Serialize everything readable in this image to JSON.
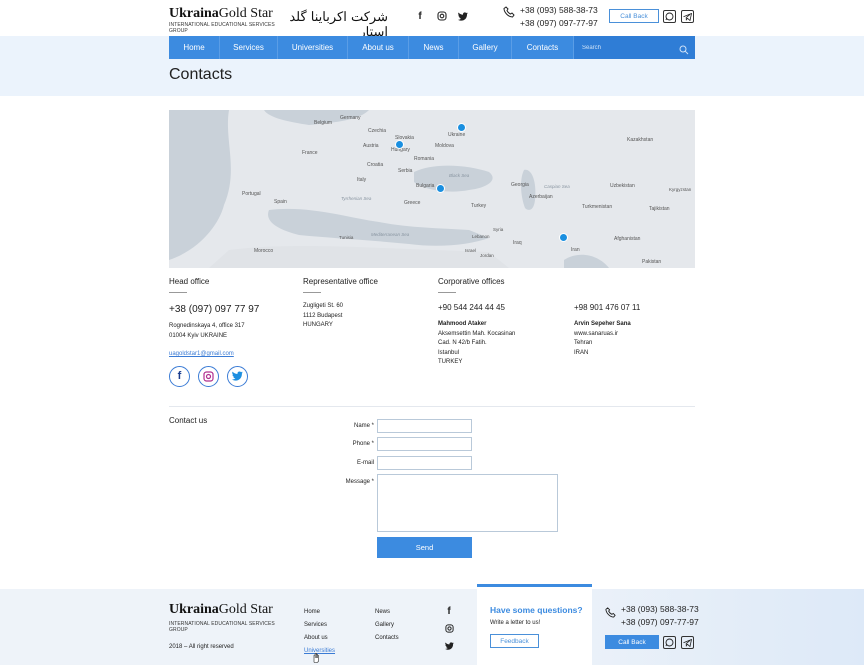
{
  "header": {
    "logo_left": "Ukraina",
    "logo_mid": "Gold",
    "logo_right": " Star",
    "logo_sub_1": "INTERNATIONAL EDUCATIONAL SERVICES",
    "logo_sub_2": "GROUP",
    "arabic_title": "شركت اكرباينا گلد استار",
    "phone_1": "+38 (093) 588-38-73",
    "phone_2": "+38 (097) 097-77-97",
    "call_back": "Call Back"
  },
  "nav": {
    "items": [
      "Home",
      "Services",
      "Universities",
      "About us",
      "News",
      "Gallery",
      "Contacts"
    ],
    "search_placeholder": "Search"
  },
  "page_title": "Contacts",
  "map": {
    "labels": [
      "Germany",
      "Belgium",
      "Czechia",
      "Slovakia",
      "Austria",
      "Hungary",
      "France",
      "Croatia",
      "Romania",
      "Serbia",
      "Italy",
      "Bulgaria",
      "Portugal",
      "Spain",
      "Greece",
      "Turkey",
      "Moldova",
      "Ukraine",
      "Georgia",
      "Azerbaijan",
      "Kazakhstan",
      "Uzbekistan",
      "Kyrgyzstan",
      "Turkmenistan",
      "Tajikistan",
      "Afghanistan",
      "Pakistan",
      "Iran",
      "Iraq",
      "Syria",
      "Lebanon",
      "Israel",
      "Jordan",
      "Morocco",
      "Tunisia"
    ],
    "seas": [
      "Black Sea",
      "Caspian Sea",
      "Tyrrhenian Sea",
      "Mediterranean Sea"
    ]
  },
  "offices": {
    "head": {
      "title": "Head office",
      "phone": "+38 (097) 097 77 97",
      "address_1": "Rognedinskaya 4, office 317",
      "address_2": "01004 Kyiv UKRAINE",
      "email": "uagoldstar1@gmail.com"
    },
    "representative": {
      "title": "Representative office",
      "address_1": "Zugligeti St. 60",
      "address_2": "1112 Budapest",
      "address_3": "HUNGARY"
    },
    "corporate": {
      "title": "Corporative offices",
      "turkey": {
        "phone": "+90 544 244 44 45",
        "name": "Mahmood Ataker",
        "line_1": "Aksemsettin Mah. Kocasinan",
        "line_2": "Cad. N 42/b Fatih.",
        "line_3": "Istanbul",
        "line_4": "TURKEY"
      },
      "iran": {
        "phone": "+98 901 476 07 11",
        "name": "Arvin Sepeher Sana",
        "line_1": "www.sanaruas.ir",
        "line_2": "Tehran",
        "line_3": "IRAN"
      }
    }
  },
  "contact_form": {
    "title": "Contact us",
    "name_label": "Name *",
    "phone_label": "Phone *",
    "email_label": "E-mail",
    "message_label": "Message *",
    "send": "Send"
  },
  "footer": {
    "logo_left": "Ukraina",
    "logo_mid": "Gold",
    "logo_right": " Star",
    "logo_sub_1": "INTERNATIONAL EDUCATIONAL SERVICES",
    "logo_sub_2": "GROUP",
    "copyright": "2018 – All right reserved",
    "links_col1": [
      "Home",
      "Services",
      "About us",
      "Universities"
    ],
    "links_col2": [
      "News",
      "Gallery",
      "Contacts"
    ],
    "card_title": "Have some questions?",
    "card_text": "Write a letter to us!",
    "feedback": "Feedback",
    "phone_1": "+38 (093) 588-38-73",
    "phone_2": "+38 (097) 097-77-97",
    "call_back": "Call Back"
  },
  "colors": {
    "accent": "#3c8be0",
    "band": "#ebf3fc",
    "pin": "#1a8fe0"
  }
}
